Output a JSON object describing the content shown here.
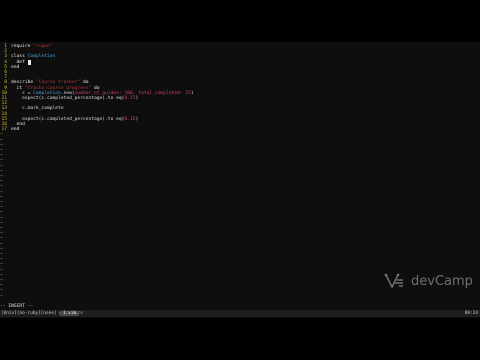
{
  "code_lines": [
    {
      "n": "1",
      "parts": [
        {
          "t": "require ",
          "c": "kw"
        },
        {
          "t": "\"rspec\"",
          "c": "str"
        }
      ]
    },
    {
      "n": "2",
      "parts": []
    },
    {
      "n": "3",
      "parts": [
        {
          "t": "class ",
          "c": "kw"
        },
        {
          "t": "Completion",
          "c": "cls"
        }
      ]
    },
    {
      "n": "4",
      "parts": [
        {
          "t": "  def ",
          "c": "kw"
        }
      ],
      "cursor": true
    },
    {
      "n": "5",
      "parts": [
        {
          "t": "end",
          "c": "kw"
        }
      ]
    },
    {
      "n": "6",
      "parts": []
    },
    {
      "n": "7",
      "parts": []
    },
    {
      "n": "8",
      "parts": [
        {
          "t": "describe ",
          "c": "kw"
        },
        {
          "t": "\"Course tracker\"",
          "c": "str"
        },
        {
          "t": " do",
          "c": "kw"
        }
      ]
    },
    {
      "n": "9",
      "parts": [
        {
          "t": "  it ",
          "c": "kw"
        },
        {
          "t": "\"tracks course progress\"",
          "c": "str"
        },
        {
          "t": " do",
          "c": "kw"
        }
      ]
    },
    {
      "n": "10",
      "parts": [
        {
          "t": "    c = ",
          "c": "txt"
        },
        {
          "t": "Completion",
          "c": "cls"
        },
        {
          "t": ".new(",
          "c": "txt"
        },
        {
          "t": "number_of_guides: ",
          "c": "sym"
        },
        {
          "t": "100, ",
          "c": "num"
        },
        {
          "t": "total_completed: ",
          "c": "sym"
        },
        {
          "t": "15",
          "c": "num"
        },
        {
          "t": ")",
          "c": "txt"
        }
      ]
    },
    {
      "n": "11",
      "parts": [
        {
          "t": "    expect(c.completed_percentage).to eq(",
          "c": "txt"
        },
        {
          "t": "0.15",
          "c": "num"
        },
        {
          "t": ")",
          "c": "txt"
        }
      ]
    },
    {
      "n": "12",
      "parts": []
    },
    {
      "n": "13",
      "parts": [
        {
          "t": "    c.mark_complete",
          "c": "txt"
        }
      ]
    },
    {
      "n": "14",
      "parts": []
    },
    {
      "n": "15",
      "parts": [
        {
          "t": "    expect(c.completed_percentage).to eq(",
          "c": "txt"
        },
        {
          "t": "0.16",
          "c": "num"
        },
        {
          "t": ")",
          "c": "txt"
        }
      ]
    },
    {
      "n": "16",
      "parts": [
        {
          "t": "  end",
          "c": "kw"
        }
      ]
    },
    {
      "n": "17",
      "parts": [
        {
          "t": "end",
          "c": "kw"
        }
      ]
    }
  ],
  "tilde_char": "~",
  "tilde_count": 47,
  "mode_text": "-- INSERT --",
  "status_left": "[Unix][no-ruby][none] gems@docs",
  "status_tab": "1:vim",
  "status_time": "09:24",
  "watermark_text": "devCamp"
}
